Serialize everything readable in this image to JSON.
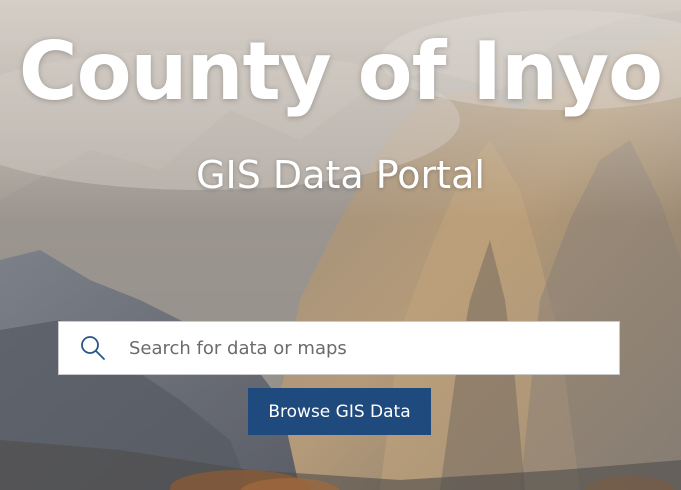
{
  "hero": {
    "title": "County of Inyo",
    "subtitle": "GIS Data Portal",
    "background_image": "mountain-landscape"
  },
  "search": {
    "placeholder": "Search for data or maps",
    "value": "",
    "icon": "search-icon"
  },
  "browse_button": {
    "label": "Browse GIS Data"
  },
  "colors": {
    "button_bg": "#1f4a7e",
    "title_text": "#ffffff",
    "search_icon": "#1f4a7e"
  }
}
